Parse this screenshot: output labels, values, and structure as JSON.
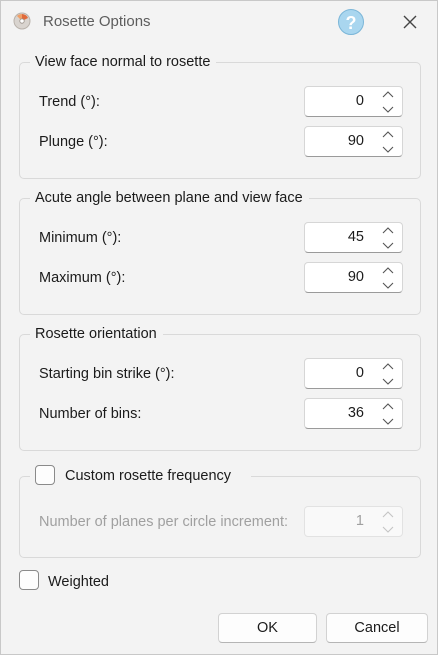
{
  "window": {
    "title": "Rosette Options"
  },
  "groups": {
    "view_face": {
      "legend": "View face normal to rosette",
      "trend": {
        "label": "Trend (°):",
        "value": "0"
      },
      "plunge": {
        "label": "Plunge (°):",
        "value": "90"
      }
    },
    "acute_angle": {
      "legend": "Acute angle between plane and view face",
      "minimum": {
        "label": "Minimum (°):",
        "value": "45"
      },
      "maximum": {
        "label": "Maximum (°):",
        "value": "90"
      }
    },
    "orientation": {
      "legend": "Rosette orientation",
      "start_strike": {
        "label": "Starting bin strike (°):",
        "value": "0"
      },
      "num_bins": {
        "label": "Number of bins:",
        "value": "36"
      }
    },
    "frequency": {
      "legend": "Custom rosette frequency",
      "checked": false,
      "planes_per_increment": {
        "label": "Number of planes per circle increment:",
        "value": "1",
        "enabled": false
      }
    }
  },
  "weighted": {
    "label": "Weighted",
    "checked": false
  },
  "buttons": {
    "ok": "OK",
    "cancel": "Cancel"
  },
  "colors": {
    "help_accent": "#a9d6ef",
    "border": "#d9d9d9"
  }
}
